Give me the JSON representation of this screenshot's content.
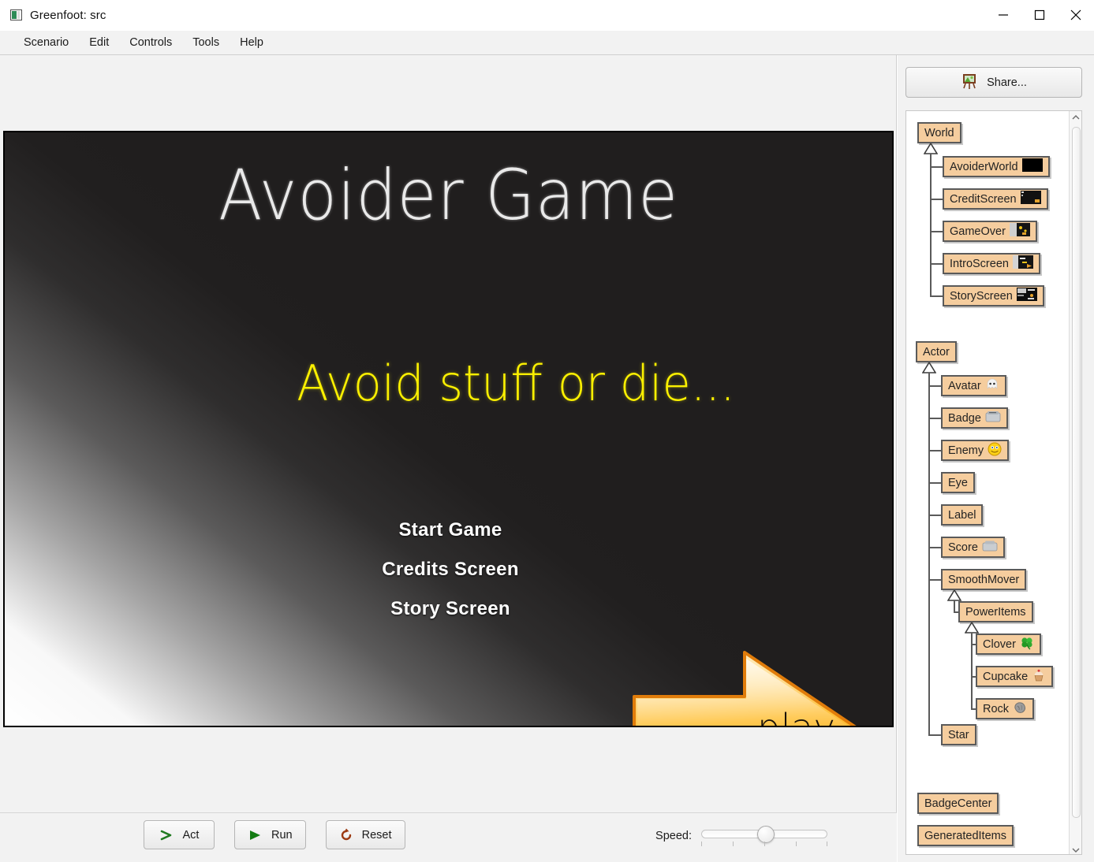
{
  "window": {
    "title": "Greenfoot: src",
    "app_icon": "greenfoot-icon",
    "controls": {
      "minimize": "minimize-icon",
      "maximize": "maximize-icon",
      "close": "close-icon"
    }
  },
  "menubar": {
    "items": [
      {
        "label": "Scenario"
      },
      {
        "label": "Edit"
      },
      {
        "label": "Controls"
      },
      {
        "label": "Tools"
      },
      {
        "label": "Help"
      }
    ]
  },
  "world": {
    "title": "Avoider Game",
    "subtitle": "Avoid stuff or die...",
    "menu_options": [
      "Start Game",
      "Credits Screen",
      "Story Screen"
    ],
    "play_button_label": "play",
    "background_color": "#201e1e",
    "title_color": "#e9e9e9",
    "subtitle_color": "#fbf000",
    "arrow_color": "#f7a81b"
  },
  "controls": {
    "act": {
      "label": "Act",
      "icon": "chevron-right-icon",
      "icon_color": "#1f7a1f"
    },
    "run": {
      "label": "Run",
      "icon": "play-triangle-icon",
      "icon_color": "#137c13"
    },
    "reset": {
      "label": "Reset",
      "icon": "reset-circular-arrow-icon",
      "icon_color": "#9c3a12"
    },
    "speed": {
      "label": "Speed:",
      "value_percent": 45
    }
  },
  "share": {
    "label": "Share...",
    "icon": "easel-picture-icon"
  },
  "class_tree": {
    "scrollbar": {
      "up": "chevron-up-icon",
      "down": "chevron-down-icon"
    },
    "world_root": {
      "label": "World"
    },
    "world_children": [
      {
        "label": "AvoiderWorld",
        "thumb": "world-thumb-black"
      },
      {
        "label": "CreditScreen",
        "thumb": "world-thumb-credit"
      },
      {
        "label": "GameOver",
        "thumb": "world-thumb-gameover"
      },
      {
        "label": "IntroScreen",
        "thumb": "world-thumb-intro"
      },
      {
        "label": "StoryScreen",
        "thumb": "world-thumb-story"
      }
    ],
    "actor_root": {
      "label": "Actor"
    },
    "actor_children": [
      {
        "label": "Avatar",
        "thumb": "ghost-icon"
      },
      {
        "label": "Badge",
        "thumb": "badge-icon"
      },
      {
        "label": "Enemy",
        "thumb": "smiley-icon"
      },
      {
        "label": "Eye",
        "thumb": ""
      },
      {
        "label": "Label",
        "thumb": ""
      },
      {
        "label": "Score",
        "thumb": "score-icon"
      },
      {
        "label": "SmoothMover",
        "thumb": ""
      },
      {
        "label": "Star",
        "thumb": ""
      }
    ],
    "smoothmover_child": {
      "label": "PowerItems"
    },
    "poweritems_children": [
      {
        "label": "Clover",
        "thumb": "clover-icon"
      },
      {
        "label": "Cupcake",
        "thumb": "cupcake-icon"
      },
      {
        "label": "Rock",
        "thumb": "rock-icon"
      }
    ],
    "other_classes": [
      {
        "label": "BadgeCenter"
      },
      {
        "label": "GeneratedItems"
      }
    ]
  }
}
